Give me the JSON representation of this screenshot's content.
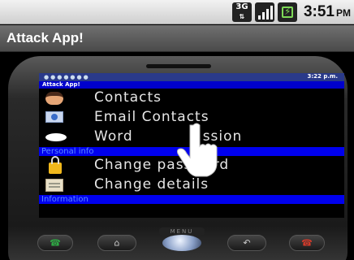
{
  "status_bar": {
    "network": "3G",
    "network_icon": "3g-data-icon",
    "signal_icon": "signal-strength-icon",
    "battery_icon": "battery-charging-icon",
    "time": "3:51",
    "ampm": "PM"
  },
  "app": {
    "title": "Attack App!"
  },
  "phone_screenshot": {
    "status_time": "3:22 p.m.",
    "app_title": "Attack App!",
    "items": [
      {
        "label": "Contacts",
        "icon": "contacts-face-icon"
      },
      {
        "label": "Email Contacts",
        "icon": "email-envelope-icon"
      },
      {
        "label": "Word",
        "icon": "cloud-blob-icon",
        "tail": "ssion"
      }
    ],
    "section_personal": "Personal info",
    "personal_items": [
      {
        "label": "Change password",
        "icon": "lock-icon"
      },
      {
        "label": "Change details",
        "icon": "id-card-icon"
      }
    ],
    "section_information": "Information",
    "menu_label": "MENU",
    "buttons": {
      "call": "☎",
      "home": "⌂",
      "back": "↶",
      "end_call": "☎"
    }
  }
}
